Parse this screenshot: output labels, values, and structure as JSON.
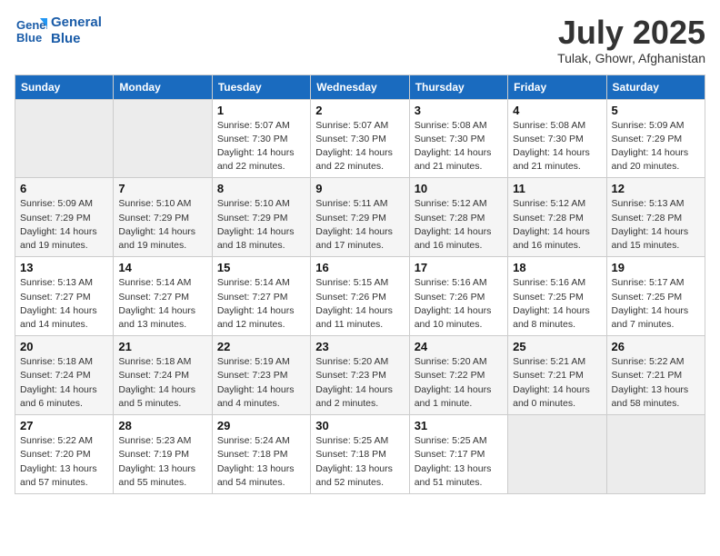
{
  "logo": {
    "line1": "General",
    "line2": "Blue"
  },
  "title": "July 2025",
  "subtitle": "Tulak, Ghowr, Afghanistan",
  "days_header": [
    "Sunday",
    "Monday",
    "Tuesday",
    "Wednesday",
    "Thursday",
    "Friday",
    "Saturday"
  ],
  "weeks": [
    [
      {
        "num": "",
        "info": ""
      },
      {
        "num": "",
        "info": ""
      },
      {
        "num": "1",
        "info": "Sunrise: 5:07 AM\nSunset: 7:30 PM\nDaylight: 14 hours and 22 minutes."
      },
      {
        "num": "2",
        "info": "Sunrise: 5:07 AM\nSunset: 7:30 PM\nDaylight: 14 hours and 22 minutes."
      },
      {
        "num": "3",
        "info": "Sunrise: 5:08 AM\nSunset: 7:30 PM\nDaylight: 14 hours and 21 minutes."
      },
      {
        "num": "4",
        "info": "Sunrise: 5:08 AM\nSunset: 7:30 PM\nDaylight: 14 hours and 21 minutes."
      },
      {
        "num": "5",
        "info": "Sunrise: 5:09 AM\nSunset: 7:29 PM\nDaylight: 14 hours and 20 minutes."
      }
    ],
    [
      {
        "num": "6",
        "info": "Sunrise: 5:09 AM\nSunset: 7:29 PM\nDaylight: 14 hours and 19 minutes."
      },
      {
        "num": "7",
        "info": "Sunrise: 5:10 AM\nSunset: 7:29 PM\nDaylight: 14 hours and 19 minutes."
      },
      {
        "num": "8",
        "info": "Sunrise: 5:10 AM\nSunset: 7:29 PM\nDaylight: 14 hours and 18 minutes."
      },
      {
        "num": "9",
        "info": "Sunrise: 5:11 AM\nSunset: 7:29 PM\nDaylight: 14 hours and 17 minutes."
      },
      {
        "num": "10",
        "info": "Sunrise: 5:12 AM\nSunset: 7:28 PM\nDaylight: 14 hours and 16 minutes."
      },
      {
        "num": "11",
        "info": "Sunrise: 5:12 AM\nSunset: 7:28 PM\nDaylight: 14 hours and 16 minutes."
      },
      {
        "num": "12",
        "info": "Sunrise: 5:13 AM\nSunset: 7:28 PM\nDaylight: 14 hours and 15 minutes."
      }
    ],
    [
      {
        "num": "13",
        "info": "Sunrise: 5:13 AM\nSunset: 7:27 PM\nDaylight: 14 hours and 14 minutes."
      },
      {
        "num": "14",
        "info": "Sunrise: 5:14 AM\nSunset: 7:27 PM\nDaylight: 14 hours and 13 minutes."
      },
      {
        "num": "15",
        "info": "Sunrise: 5:14 AM\nSunset: 7:27 PM\nDaylight: 14 hours and 12 minutes."
      },
      {
        "num": "16",
        "info": "Sunrise: 5:15 AM\nSunset: 7:26 PM\nDaylight: 14 hours and 11 minutes."
      },
      {
        "num": "17",
        "info": "Sunrise: 5:16 AM\nSunset: 7:26 PM\nDaylight: 14 hours and 10 minutes."
      },
      {
        "num": "18",
        "info": "Sunrise: 5:16 AM\nSunset: 7:25 PM\nDaylight: 14 hours and 8 minutes."
      },
      {
        "num": "19",
        "info": "Sunrise: 5:17 AM\nSunset: 7:25 PM\nDaylight: 14 hours and 7 minutes."
      }
    ],
    [
      {
        "num": "20",
        "info": "Sunrise: 5:18 AM\nSunset: 7:24 PM\nDaylight: 14 hours and 6 minutes."
      },
      {
        "num": "21",
        "info": "Sunrise: 5:18 AM\nSunset: 7:24 PM\nDaylight: 14 hours and 5 minutes."
      },
      {
        "num": "22",
        "info": "Sunrise: 5:19 AM\nSunset: 7:23 PM\nDaylight: 14 hours and 4 minutes."
      },
      {
        "num": "23",
        "info": "Sunrise: 5:20 AM\nSunset: 7:23 PM\nDaylight: 14 hours and 2 minutes."
      },
      {
        "num": "24",
        "info": "Sunrise: 5:20 AM\nSunset: 7:22 PM\nDaylight: 14 hours and 1 minute."
      },
      {
        "num": "25",
        "info": "Sunrise: 5:21 AM\nSunset: 7:21 PM\nDaylight: 14 hours and 0 minutes."
      },
      {
        "num": "26",
        "info": "Sunrise: 5:22 AM\nSunset: 7:21 PM\nDaylight: 13 hours and 58 minutes."
      }
    ],
    [
      {
        "num": "27",
        "info": "Sunrise: 5:22 AM\nSunset: 7:20 PM\nDaylight: 13 hours and 57 minutes."
      },
      {
        "num": "28",
        "info": "Sunrise: 5:23 AM\nSunset: 7:19 PM\nDaylight: 13 hours and 55 minutes."
      },
      {
        "num": "29",
        "info": "Sunrise: 5:24 AM\nSunset: 7:18 PM\nDaylight: 13 hours and 54 minutes."
      },
      {
        "num": "30",
        "info": "Sunrise: 5:25 AM\nSunset: 7:18 PM\nDaylight: 13 hours and 52 minutes."
      },
      {
        "num": "31",
        "info": "Sunrise: 5:25 AM\nSunset: 7:17 PM\nDaylight: 13 hours and 51 minutes."
      },
      {
        "num": "",
        "info": ""
      },
      {
        "num": "",
        "info": ""
      }
    ]
  ]
}
